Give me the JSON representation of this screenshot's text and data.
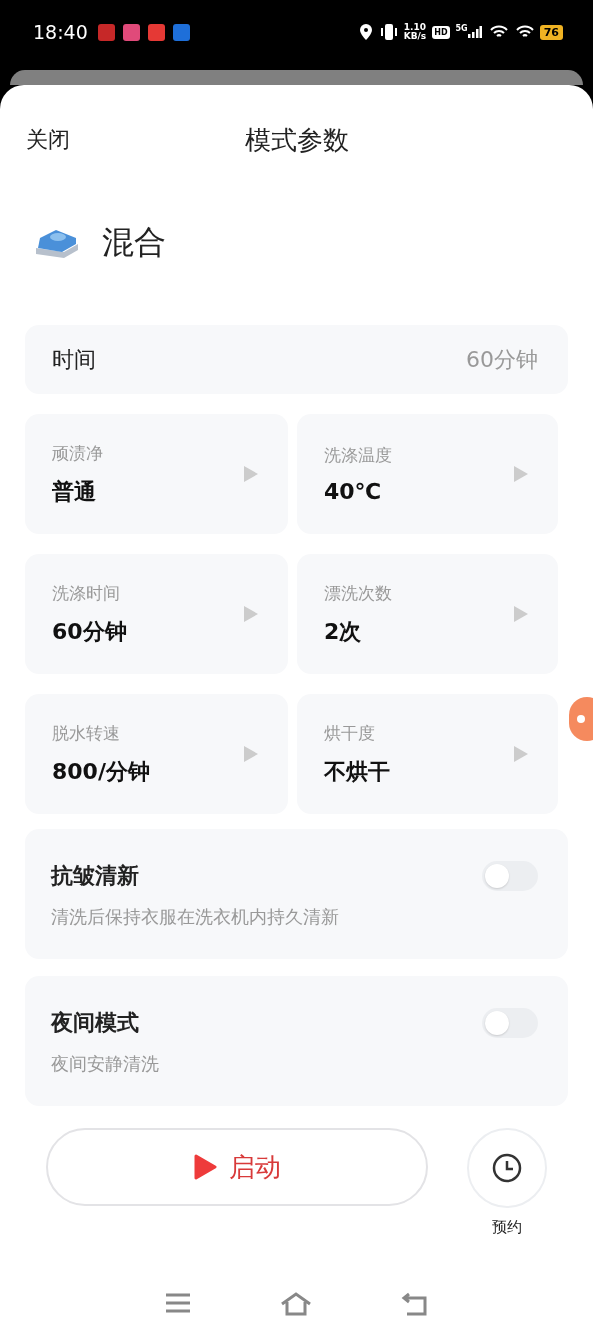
{
  "status_bar": {
    "time": "18:40",
    "speed": "1.10",
    "speed_unit": "KB/s",
    "hd": "HD",
    "network": "5G",
    "battery": "76"
  },
  "header": {
    "close": "关闭",
    "title": "模式参数"
  },
  "mode": {
    "name": "混合"
  },
  "time_row": {
    "label": "时间",
    "value": "60分钟"
  },
  "settings": [
    {
      "label": "顽渍净",
      "value": "普通"
    },
    {
      "label": "洗涤温度",
      "value": "40℃"
    },
    {
      "label": "洗涤时间",
      "value": "60分钟"
    },
    {
      "label": "漂洗次数",
      "value": "2次"
    },
    {
      "label": "脱水转速",
      "value": "800/分钟"
    },
    {
      "label": "烘干度",
      "value": "不烘干"
    }
  ],
  "toggles": [
    {
      "title": "抗皱清新",
      "description": "清洗后保持衣服在洗衣机内持久清新",
      "on": false
    },
    {
      "title": "夜间模式",
      "description": "夜间安静清洗",
      "on": false
    }
  ],
  "actions": {
    "start": "启动",
    "schedule": "预约"
  }
}
